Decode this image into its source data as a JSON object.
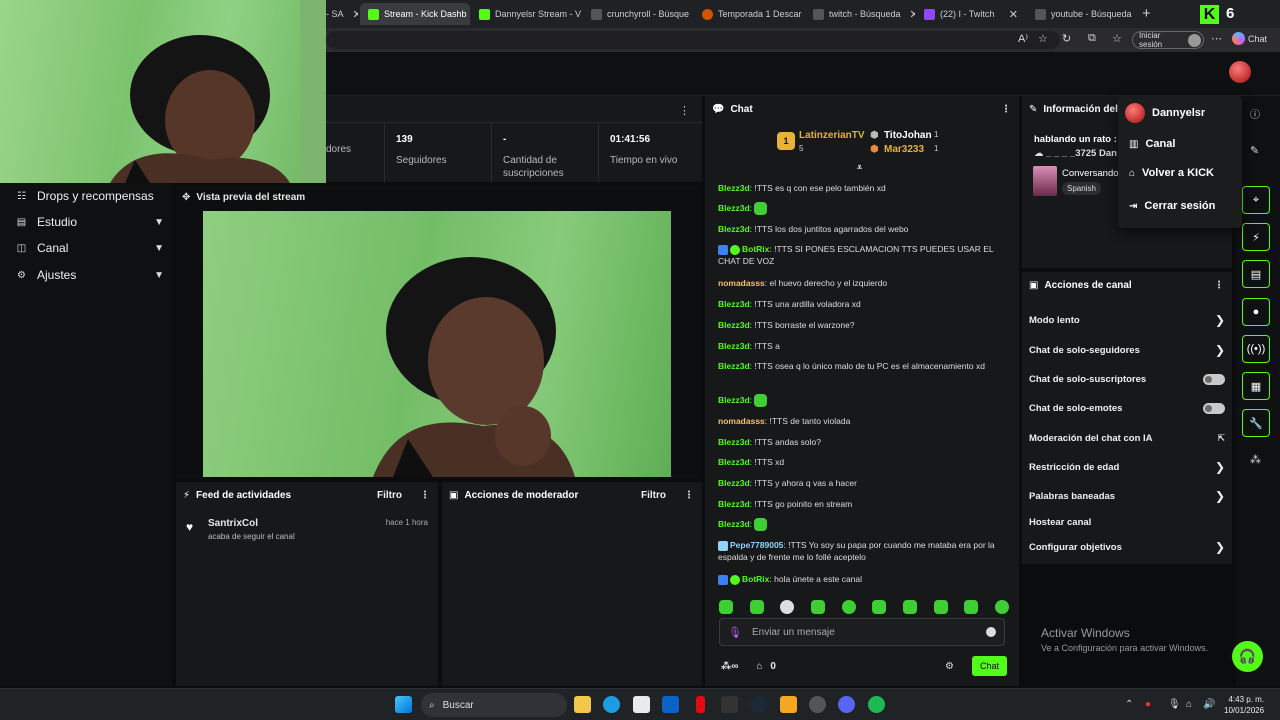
{
  "browser": {
    "tabs": [
      {
        "label": "- SA",
        "active": false,
        "color": "#777777"
      },
      {
        "label": "Stream - Kick Dashb",
        "active": true,
        "color": "#53fc18"
      },
      {
        "label": "Dannyelsr Stream - V",
        "active": false,
        "color": "#53fc18"
      },
      {
        "label": "crunchyroll - Búsque",
        "active": false,
        "color": "#555555"
      },
      {
        "label": "Temporada 1 Descar",
        "active": false,
        "color": "#d35400"
      },
      {
        "label": "twitch - Búsqueda",
        "active": false,
        "color": "#555555"
      },
      {
        "label": "(22) I - Twitch",
        "active": false,
        "color": "#9146ff"
      },
      {
        "label": "youtube - Búsqueda",
        "active": false,
        "color": "#555555"
      }
    ],
    "extension_count": "6",
    "login_label": "Iniciar sesión",
    "copilot_label": "Chat"
  },
  "sidebar": {
    "items": [
      {
        "label": "Drops y recompensas",
        "icon": "gift-icon",
        "chevron": false
      },
      {
        "label": "Estudio",
        "icon": "studio-icon",
        "chevron": true
      },
      {
        "label": "Canal",
        "icon": "channel-icon",
        "chevron": true
      },
      {
        "label": "Ajustes",
        "icon": "gear-icon",
        "chevron": true
      }
    ]
  },
  "stats": {
    "items": [
      {
        "value": "",
        "label": "dores"
      },
      {
        "value": "139",
        "label": "Seguidores"
      },
      {
        "value": "-",
        "label": "Cantidad de suscripciones"
      },
      {
        "value": "01:41:56",
        "label": "Tiempo en vivo"
      }
    ]
  },
  "preview": {
    "title": "Vista previa del stream"
  },
  "activity_feed": {
    "title": "Feed de actividades",
    "filter": "Filtro",
    "items": [
      {
        "name": "SantrixCol",
        "time": "hace 1 hora",
        "desc": "acaba de seguir el canal"
      }
    ]
  },
  "mod_actions": {
    "title": "Acciones de moderador",
    "filter": "Filtro"
  },
  "chat": {
    "title": "Chat",
    "pinned": [
      {
        "name": "LatinzerianTV",
        "count": "5",
        "rank": "1"
      },
      {
        "name": "TitoJohan",
        "count": "1"
      },
      {
        "name": "Mar3233",
        "count": "1"
      }
    ],
    "messages": [
      {
        "user": "Blezz3d",
        "color": "#53fc18",
        "text": ": !TTS es q con ese pelo también xd",
        "emote": false
      },
      {
        "user": "Blezz3d",
        "color": "#53fc18",
        "text": ":",
        "emote": true
      },
      {
        "user": "Blezz3d",
        "color": "#53fc18",
        "text": ": !TTS los dos juntitos agarrados del webo",
        "emote": false
      },
      {
        "user": "BotRix",
        "color": "#53fc18",
        "text": ": !TTS SI PONES ESCLAMACION TTS PUEDES USAR EL CHAT DE VOZ",
        "emote": false,
        "badge": true
      },
      {
        "user": "nomadasss",
        "color": "#f5c16c",
        "text": ": el huevo derecho y el izquierdo",
        "emote": false
      },
      {
        "user": "Blezz3d",
        "color": "#53fc18",
        "text": ": !TTS una ardilla voladora xd",
        "emote": false
      },
      {
        "user": "Blezz3d",
        "color": "#53fc18",
        "text": ": !TTS borraste el warzone?",
        "emote": false
      },
      {
        "user": "Blezz3d",
        "color": "#53fc18",
        "text": ": !TTS a",
        "emote": false
      },
      {
        "user": "Blezz3d",
        "color": "#53fc18",
        "text": ": !TTS osea q lo único malo de tu PC es el almacenamiento xd",
        "emote": false
      },
      {
        "user": "Blezz3d",
        "color": "#53fc18",
        "text": ":",
        "emote": true
      },
      {
        "user": "nomadasss",
        "color": "#f5c16c",
        "text": ": !TTS de tanto violada",
        "emote": false
      },
      {
        "user": "Blezz3d",
        "color": "#53fc18",
        "text": ": !TTS andas solo?",
        "emote": false
      },
      {
        "user": "Blezz3d",
        "color": "#53fc18",
        "text": ": !TTS xd",
        "emote": false
      },
      {
        "user": "Blezz3d",
        "color": "#53fc18",
        "text": ": !TTS y ahora q vas a hacer",
        "emote": false
      },
      {
        "user": "Blezz3d",
        "color": "#53fc18",
        "text": ": !TTS go poinito en stream",
        "emote": false
      },
      {
        "user": "Blezz3d",
        "color": "#53fc18",
        "text": ":",
        "emote": true
      },
      {
        "user": "Pepe7789005",
        "color": "#8fd3ff",
        "text": ": !TTS Yo soy su papa por cuando me mataba era por la espalda y de frente me lo follé aceptelo",
        "emote": false
      },
      {
        "user": "BotRix",
        "color": "#53fc18",
        "text": ": hola únete a este canal",
        "emote": false,
        "badge": true
      }
    ],
    "input_placeholder": "Enviar un mensaje",
    "footer_count": "0",
    "send_label": "Chat"
  },
  "info_panel": {
    "title": "Información del",
    "stream_title": "hablando un rato :",
    "line2": "☁ _ _ _ _3725 Dan",
    "conversando": "Conversando",
    "language": "Spanish"
  },
  "profile_menu": {
    "username": "Dannyelsr",
    "items": [
      {
        "label": "Canal",
        "icon": "channel-icon"
      },
      {
        "label": "Volver a KICK",
        "icon": "home-icon"
      },
      {
        "label": "Cerrar sesión",
        "icon": "logout-icon"
      }
    ]
  },
  "channel_actions": {
    "title": "Acciones de canal",
    "items": [
      {
        "label": "Modo lento",
        "control": "chevron"
      },
      {
        "label": "Chat de solo-seguidores",
        "control": "chevron"
      },
      {
        "label": "Chat de solo-suscriptores",
        "control": "toggle"
      },
      {
        "label": "Chat de solo-emotes",
        "control": "toggle"
      },
      {
        "label": "Moderación del chat con IA",
        "control": "external"
      },
      {
        "label": "Restricción de edad",
        "control": "chevron"
      },
      {
        "label": "Palabras baneadas",
        "control": "chevron"
      },
      {
        "label": "Hostear canal",
        "control": "none"
      },
      {
        "label": "Configurar objetivos",
        "control": "chevron"
      }
    ]
  },
  "watermark": {
    "title": "Activar Windows",
    "subtitle": "Ve a Configuración para activar Windows."
  },
  "taskbar": {
    "search_label": "Buscar",
    "time": "4:43 p. m.",
    "date": "10/01/2026"
  },
  "colors": {
    "accent": "#53fc18",
    "panel": "#17181a",
    "background": "#0b0c0d"
  }
}
